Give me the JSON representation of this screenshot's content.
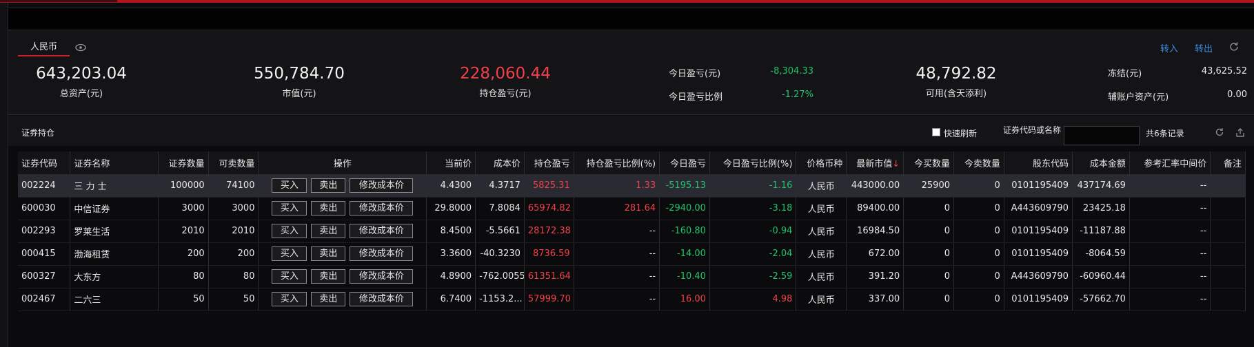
{
  "colors": {
    "accent_red": "#f0414a",
    "gain_green": "#23c36b",
    "link_blue": "#3d8fe0",
    "bg": "#0b0b0d"
  },
  "asset": {
    "currency_tab": "人民币",
    "eye_icon": "eye-icon",
    "transfer_in": "转入",
    "transfer_out": "转出",
    "total_assets_value": "643,203.04",
    "total_assets_label": "总资产(元)",
    "market_value_value": "550,784.70",
    "market_value_label": "市值(元)",
    "position_pl_value": "228,060.44",
    "position_pl_label": "持仓盈亏(元)",
    "today_pl_label": "今日盈亏(元)",
    "today_pl_value": "-8,304.33",
    "today_pl_ratio_label": "今日盈亏比例",
    "today_pl_ratio_value": "-1.27%",
    "available_value": "48,792.82",
    "available_label": "可用(含天添利)",
    "frozen_label": "冻结(元)",
    "frozen_value": "43,625.52",
    "aux_label": "辅账户资产(元)",
    "aux_value": "0.00"
  },
  "holdings": {
    "title": "证券持仓",
    "quick_refresh_label": "快速刷新",
    "search_label": "证券代码或名称",
    "search_value": "",
    "record_count": "共6条记录",
    "columns": [
      "证券代码",
      "证券名称",
      "证券数量",
      "可卖数量",
      "操作",
      "当前价",
      "成本价",
      "持仓盈亏",
      "持仓盈亏比例(%)",
      "今日盈亏",
      "今日盈亏比例(%)",
      "价格币种",
      "最新市值",
      "今买数量",
      "今卖数量",
      "股东代码",
      "成本金额",
      "参考汇率中间价",
      "备注"
    ],
    "sort_arrow": "↓",
    "buttons": {
      "buy": "买入",
      "sell": "卖出",
      "modify": "修改成本价"
    },
    "rows": [
      {
        "code": "002224",
        "name": "三 力 士",
        "qty": "100000",
        "sellable": "74100",
        "price": "4.4300",
        "cost": "4.3717",
        "pos_pl": "5825.31",
        "pos_pl_pct": "1.33",
        "today_pl": "-5195.13",
        "today_pl_pct": "-1.16",
        "currency": "人民币",
        "mkt_val": "443000.00",
        "buy_today": "25900",
        "sell_today": "0",
        "holder": "0101195409",
        "cost_amt": "437174.69",
        "fx": "--",
        "note": ""
      },
      {
        "code": "600030",
        "name": "中信证券",
        "qty": "3000",
        "sellable": "3000",
        "price": "29.8000",
        "cost": "7.8084",
        "pos_pl": "65974.82",
        "pos_pl_pct": "281.64",
        "today_pl": "-2940.00",
        "today_pl_pct": "-3.18",
        "currency": "人民币",
        "mkt_val": "89400.00",
        "buy_today": "0",
        "sell_today": "0",
        "holder": "A443609790",
        "cost_amt": "23425.18",
        "fx": "--",
        "note": ""
      },
      {
        "code": "002293",
        "name": "罗莱生活",
        "qty": "2010",
        "sellable": "2010",
        "price": "8.4500",
        "cost": "-5.5661",
        "pos_pl": "28172.38",
        "pos_pl_pct": "--",
        "today_pl": "-160.80",
        "today_pl_pct": "-0.94",
        "currency": "人民币",
        "mkt_val": "16984.50",
        "buy_today": "0",
        "sell_today": "0",
        "holder": "0101195409",
        "cost_amt": "-11187.88",
        "fx": "--",
        "note": ""
      },
      {
        "code": "000415",
        "name": "渤海租赁",
        "qty": "200",
        "sellable": "200",
        "price": "3.3600",
        "cost": "-40.3230",
        "pos_pl": "8736.59",
        "pos_pl_pct": "--",
        "today_pl": "-14.00",
        "today_pl_pct": "-2.04",
        "currency": "人民币",
        "mkt_val": "672.00",
        "buy_today": "0",
        "sell_today": "0",
        "holder": "0101195409",
        "cost_amt": "-8064.59",
        "fx": "--",
        "note": ""
      },
      {
        "code": "600327",
        "name": "大东方",
        "qty": "80",
        "sellable": "80",
        "price": "4.8900",
        "cost": "-762.0055",
        "pos_pl": "61351.64",
        "pos_pl_pct": "--",
        "today_pl": "-10.40",
        "today_pl_pct": "-2.59",
        "currency": "人民币",
        "mkt_val": "391.20",
        "buy_today": "0",
        "sell_today": "0",
        "holder": "A443609790",
        "cost_amt": "-60960.44",
        "fx": "--",
        "note": ""
      },
      {
        "code": "002467",
        "name": "二六三",
        "qty": "50",
        "sellable": "50",
        "price": "6.7400",
        "cost": "-1153.2...",
        "pos_pl": "57999.70",
        "pos_pl_pct": "--",
        "today_pl": "16.00",
        "today_pl_pct": "4.98",
        "currency": "人民币",
        "mkt_val": "337.00",
        "buy_today": "0",
        "sell_today": "0",
        "holder": "0101195409",
        "cost_amt": "-57662.70",
        "fx": "--",
        "note": ""
      }
    ]
  }
}
